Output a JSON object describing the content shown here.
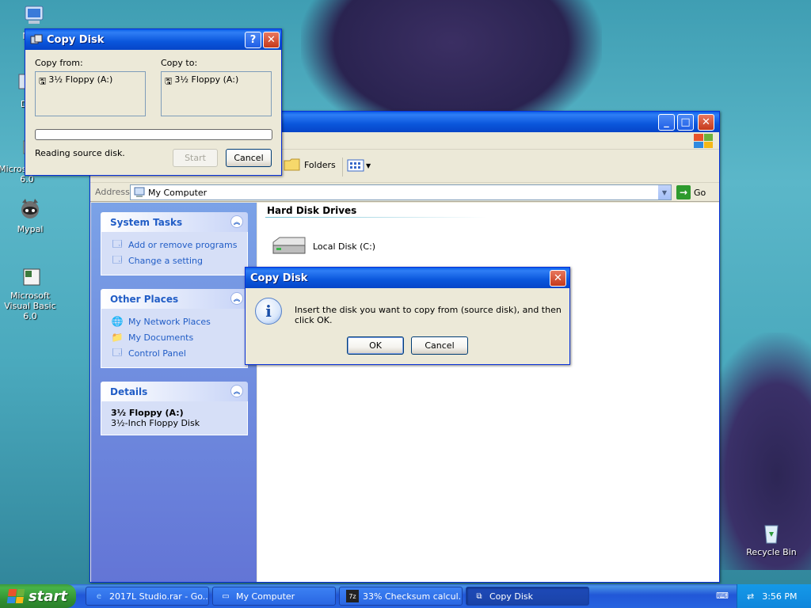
{
  "desktop": {
    "icons": [
      {
        "label": "My C"
      },
      {
        "label": "Data"
      },
      {
        "label": "Microso C++ 6.0"
      },
      {
        "label": "Mypal"
      },
      {
        "label": "Microsoft Visual Basic 6.0"
      },
      {
        "label": "Recycle Bin"
      }
    ]
  },
  "my_computer_window": {
    "toolbar": {
      "folders_label": "Folders"
    },
    "address": {
      "label": "Address",
      "value": "My Computer",
      "go_label": "Go"
    },
    "task_pane": {
      "system_tasks": {
        "title": "System Tasks",
        "links": [
          "Add or remove programs",
          "Change a setting"
        ]
      },
      "other_places": {
        "title": "Other Places",
        "links": [
          "My Network Places",
          "My Documents",
          "Control Panel"
        ]
      },
      "details": {
        "title": "Details",
        "name": "3½ Floppy (A:)",
        "description": "3½-Inch Floppy Disk"
      }
    },
    "content": {
      "group_title": "Hard Disk Drives",
      "drives": [
        {
          "label": "Local Disk (C:)"
        }
      ]
    }
  },
  "copy_disk_window": {
    "title": "Copy Disk",
    "copy_from_label": "Copy from:",
    "copy_to_label": "Copy to:",
    "copy_from_item": "3½ Floppy (A:)",
    "copy_to_item": "3½ Floppy (A:)",
    "progress": 0,
    "status": "Reading source disk.",
    "start_label": "Start",
    "cancel_label": "Cancel",
    "help_glyph": "?",
    "close_glyph": "✕"
  },
  "message_dialog": {
    "title": "Copy Disk",
    "message": "Insert the disk you want to copy from (source disk), and then click OK.",
    "ok_label": "OK",
    "cancel_label": "Cancel",
    "icon": "info-icon"
  },
  "taskbar": {
    "start_label": "start",
    "items": [
      {
        "label": "2017L Studio.rar - Go...",
        "active": false
      },
      {
        "label": "My Computer",
        "active": false
      },
      {
        "label": "33% Checksum calcul...",
        "active": false
      },
      {
        "label": "Copy Disk",
        "active": true
      }
    ],
    "clock": "3:56 PM"
  },
  "colors": {
    "title_blue": "#0a56dc",
    "start_green": "#3c9a3c",
    "link_blue": "#215dc6",
    "tray_blue": "#1599e8"
  }
}
